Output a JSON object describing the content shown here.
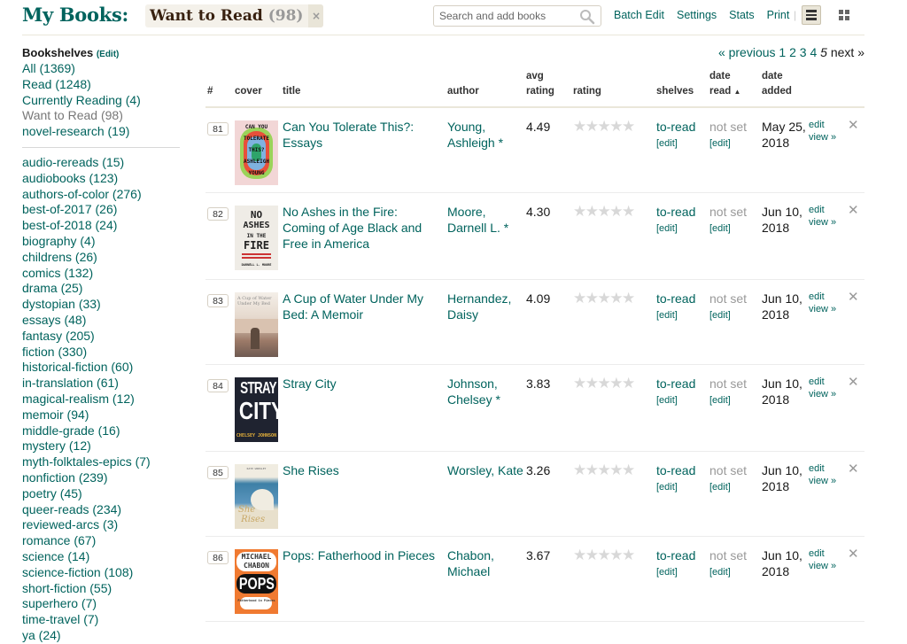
{
  "header": {
    "title": "My Books:",
    "shelf_name": "Want to Read",
    "shelf_count": "(98)",
    "remove_filter": "×",
    "search_placeholder": "Search and add books",
    "links": [
      "Batch Edit",
      "Settings",
      "Stats",
      "Print"
    ],
    "separator": "|",
    "view_modes": [
      "list-view",
      "grid-view"
    ],
    "active_view": "list-view"
  },
  "sidebar": {
    "heading": "Bookshelves",
    "edit_label": "(Edit)",
    "main_shelves": [
      {
        "label": "All (1369)",
        "current": false
      },
      {
        "label": "Read (1248)",
        "current": false
      },
      {
        "label": "Currently Reading (4)",
        "current": false
      },
      {
        "label": "Want to Read (98)",
        "current": true
      },
      {
        "label": "novel-research (19)",
        "current": false
      }
    ],
    "custom_shelves": [
      "audio-rereads (15)",
      "audiobooks (123)",
      "authors-of-color (276)",
      "best-of-2017 (26)",
      "best-of-2018 (24)",
      "biography (4)",
      "childrens (26)",
      "comics (132)",
      "drama (25)",
      "dystopian (33)",
      "essays (48)",
      "fantasy (205)",
      "fiction (330)",
      "historical-fiction (60)",
      "in-translation (61)",
      "magical-realism (12)",
      "memoir (94)",
      "middle-grade (16)",
      "mystery (12)",
      "myth-folktales-epics (7)",
      "nonfiction (239)",
      "poetry (45)",
      "queer-reads (234)",
      "reviewed-arcs (3)",
      "romance (67)",
      "science (14)",
      "science-fiction (108)",
      "short-fiction (55)",
      "superhero (7)",
      "time-travel (7)",
      "ya (24)"
    ]
  },
  "pagination": {
    "previous": "« previous",
    "pages": [
      "1",
      "2",
      "3",
      "4"
    ],
    "current": "5",
    "next": "next »"
  },
  "table": {
    "columns": {
      "num": "#",
      "cover": "cover",
      "title": "title",
      "author": "author",
      "avg_rating_1": "avg",
      "avg_rating_2": "rating",
      "rating": "rating",
      "shelves": "shelves",
      "date_read_1": "date",
      "date_read_2": "read",
      "sort_arrow": "▲",
      "date_added_1": "date",
      "date_added_2": "added"
    },
    "rows": [
      {
        "num": "81",
        "title": "Can You Tolerate This?: Essays",
        "author": "Young, Ashleigh *",
        "avg_rating": "4.49",
        "user_rating": 0,
        "shelf": "to-read",
        "shelf_edit": "[edit]",
        "date_read": "not set",
        "date_read_edit": "[edit]",
        "date_added": "May 25, 2018",
        "edit": "edit",
        "view": "view »",
        "cover_text": [
          "CAN YOU",
          "TOLERATE",
          "THIS?",
          "ASHLEIGH",
          "YOUNG"
        ]
      },
      {
        "num": "82",
        "title": "No Ashes in the Fire: Coming of Age Black and Free in America",
        "author": "Moore, Darnell L. *",
        "avg_rating": "4.30",
        "user_rating": 0,
        "shelf": "to-read",
        "shelf_edit": "[edit]",
        "date_read": "not set",
        "date_read_edit": "[edit]",
        "date_added": "Jun 10, 2018",
        "edit": "edit",
        "view": "view »",
        "cover_text": [
          "NO",
          "ASHES",
          "IN THE",
          "FIRE",
          "DARNELL L. MOORE"
        ]
      },
      {
        "num": "83",
        "title": "A Cup of Water Under My Bed: A Memoir",
        "author": "Hernandez, Daisy",
        "avg_rating": "4.09",
        "user_rating": 0,
        "shelf": "to-read",
        "shelf_edit": "[edit]",
        "date_read": "not set",
        "date_read_edit": "[edit]",
        "date_added": "Jun 10, 2018",
        "edit": "edit",
        "view": "view »",
        "cover_text": [
          "A Cup of Water",
          "Under My Bed"
        ]
      },
      {
        "num": "84",
        "title": "Stray City",
        "author": "Johnson, Chelsey *",
        "avg_rating": "3.83",
        "user_rating": 0,
        "shelf": "to-read",
        "shelf_edit": "[edit]",
        "date_read": "not set",
        "date_read_edit": "[edit]",
        "date_added": "Jun 10, 2018",
        "edit": "edit",
        "view": "view »",
        "cover_text": [
          "STRAY",
          "CITY",
          "CHELSEY JOHNSON"
        ]
      },
      {
        "num": "85",
        "title": "She Rises",
        "author": "Worsley, Kate",
        "avg_rating": "3.26",
        "user_rating": 0,
        "shelf": "to-read",
        "shelf_edit": "[edit]",
        "date_read": "not set",
        "date_read_edit": "[edit]",
        "date_added": "Jun 10, 2018",
        "edit": "edit",
        "view": "view »",
        "cover_text": [
          "KATE WORSLEY",
          "She",
          "Rises"
        ]
      },
      {
        "num": "86",
        "title": "Pops: Fatherhood in Pieces",
        "author": "Chabon, Michael",
        "avg_rating": "3.67",
        "user_rating": 0,
        "shelf": "to-read",
        "shelf_edit": "[edit]",
        "date_read": "not set",
        "date_read_edit": "[edit]",
        "date_added": "Jun 10, 2018",
        "edit": "edit",
        "view": "view »",
        "cover_text": [
          "MICHAEL",
          "CHABON",
          "POPS",
          "Fatherhood in Pieces"
        ]
      }
    ]
  },
  "colors": {
    "brand_green": "#00635d",
    "header_brown": "#382110",
    "pill_bg": "#f4f1ea",
    "star_empty": "#d8d8d8"
  }
}
